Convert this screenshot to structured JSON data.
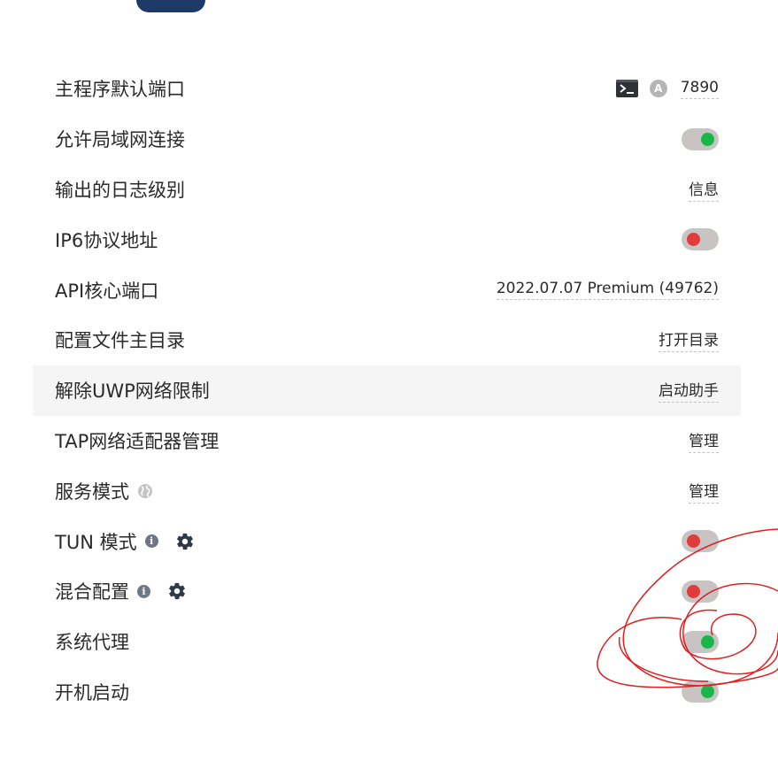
{
  "settings": {
    "mixin_port": {
      "label": "主程序默认端口",
      "value": "7890",
      "terminal_icon": "terminal-icon",
      "auto_icon_letter": "A"
    },
    "allow_lan": {
      "label": "允许局域网连接",
      "state": "on"
    },
    "log_level": {
      "label": "输出的日志级别",
      "value": "信息"
    },
    "ipv6": {
      "label": "IP6协议地址",
      "state": "off"
    },
    "api_port": {
      "label": "API核心端口",
      "value": "2022.07.07 Premium (49762)"
    },
    "config_dir": {
      "label": "配置文件主目录",
      "value": "打开目录"
    },
    "uwp": {
      "label": "解除UWP网络限制",
      "value": "启动助手"
    },
    "tap": {
      "label": "TAP网络适配器管理",
      "value": "管理"
    },
    "service_mode": {
      "label": "服务模式",
      "value": "管理",
      "icon": "globe-icon"
    },
    "tun_mode": {
      "label": "TUN 模式",
      "state": "off",
      "icons": [
        "info-icon",
        "gear-icon"
      ]
    },
    "mixin": {
      "label": "混合配置",
      "state": "off",
      "icons": [
        "info-icon",
        "gear-icon"
      ]
    },
    "system_proxy": {
      "label": "系统代理",
      "state": "on"
    },
    "auto_start": {
      "label": "开机启动",
      "state": "on"
    }
  },
  "colors": {
    "toggle_track": "#c8c4c4",
    "toggle_on": "#18b648",
    "toggle_off": "#e03c3c",
    "annotation": "#e02020",
    "logo": "#1e3a66"
  }
}
